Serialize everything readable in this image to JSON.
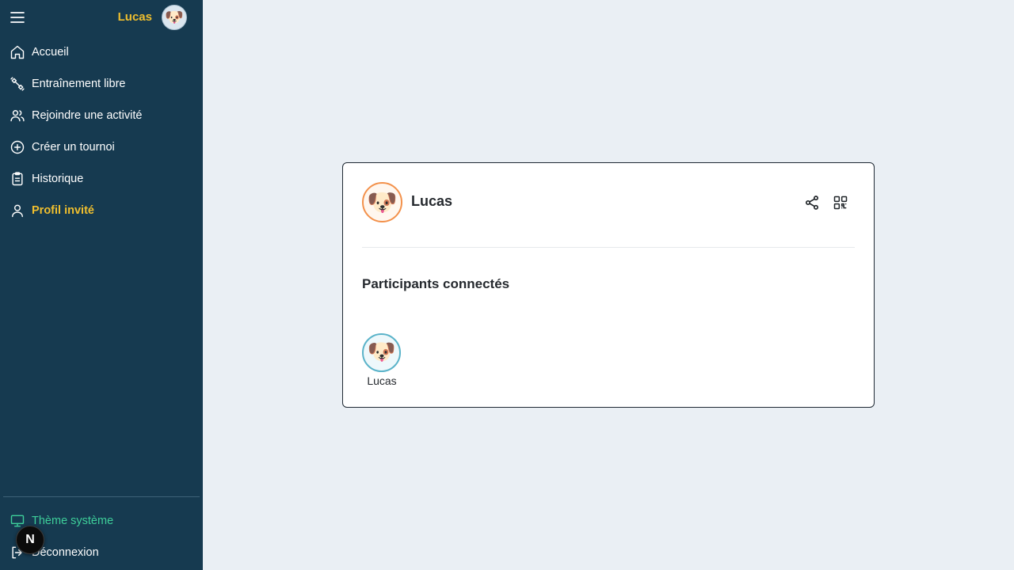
{
  "sidebar": {
    "user_name": "Lucas",
    "avatar_emoji": "🐶",
    "items": [
      {
        "label": "Accueil",
        "icon": "home-icon"
      },
      {
        "label": "Entraînement libre",
        "icon": "dumbbell-icon"
      },
      {
        "label": "Rejoindre une activité",
        "icon": "users-icon"
      },
      {
        "label": "Créer un tournoi",
        "icon": "plus-circle-icon"
      },
      {
        "label": "Historique",
        "icon": "clipboard-icon"
      },
      {
        "label": "Profil invité",
        "icon": "user-icon",
        "active": true
      }
    ],
    "theme_label": "Thème système",
    "logout_label": "Déconnexion",
    "dev_badge": "N"
  },
  "card": {
    "user_name": "Lucas",
    "avatar_emoji": "🐶",
    "section_title": "Participants connectés",
    "participants": [
      {
        "name": "Lucas",
        "avatar_emoji": "🐶"
      }
    ]
  },
  "colors": {
    "sidebar_bg": "#163a50",
    "accent_yellow": "#f0bf2e",
    "theme_green": "#3ecf9a",
    "page_bg": "#eaeff4",
    "host_ring": "#f3914b",
    "participant_ring": "#5ab3c9"
  }
}
